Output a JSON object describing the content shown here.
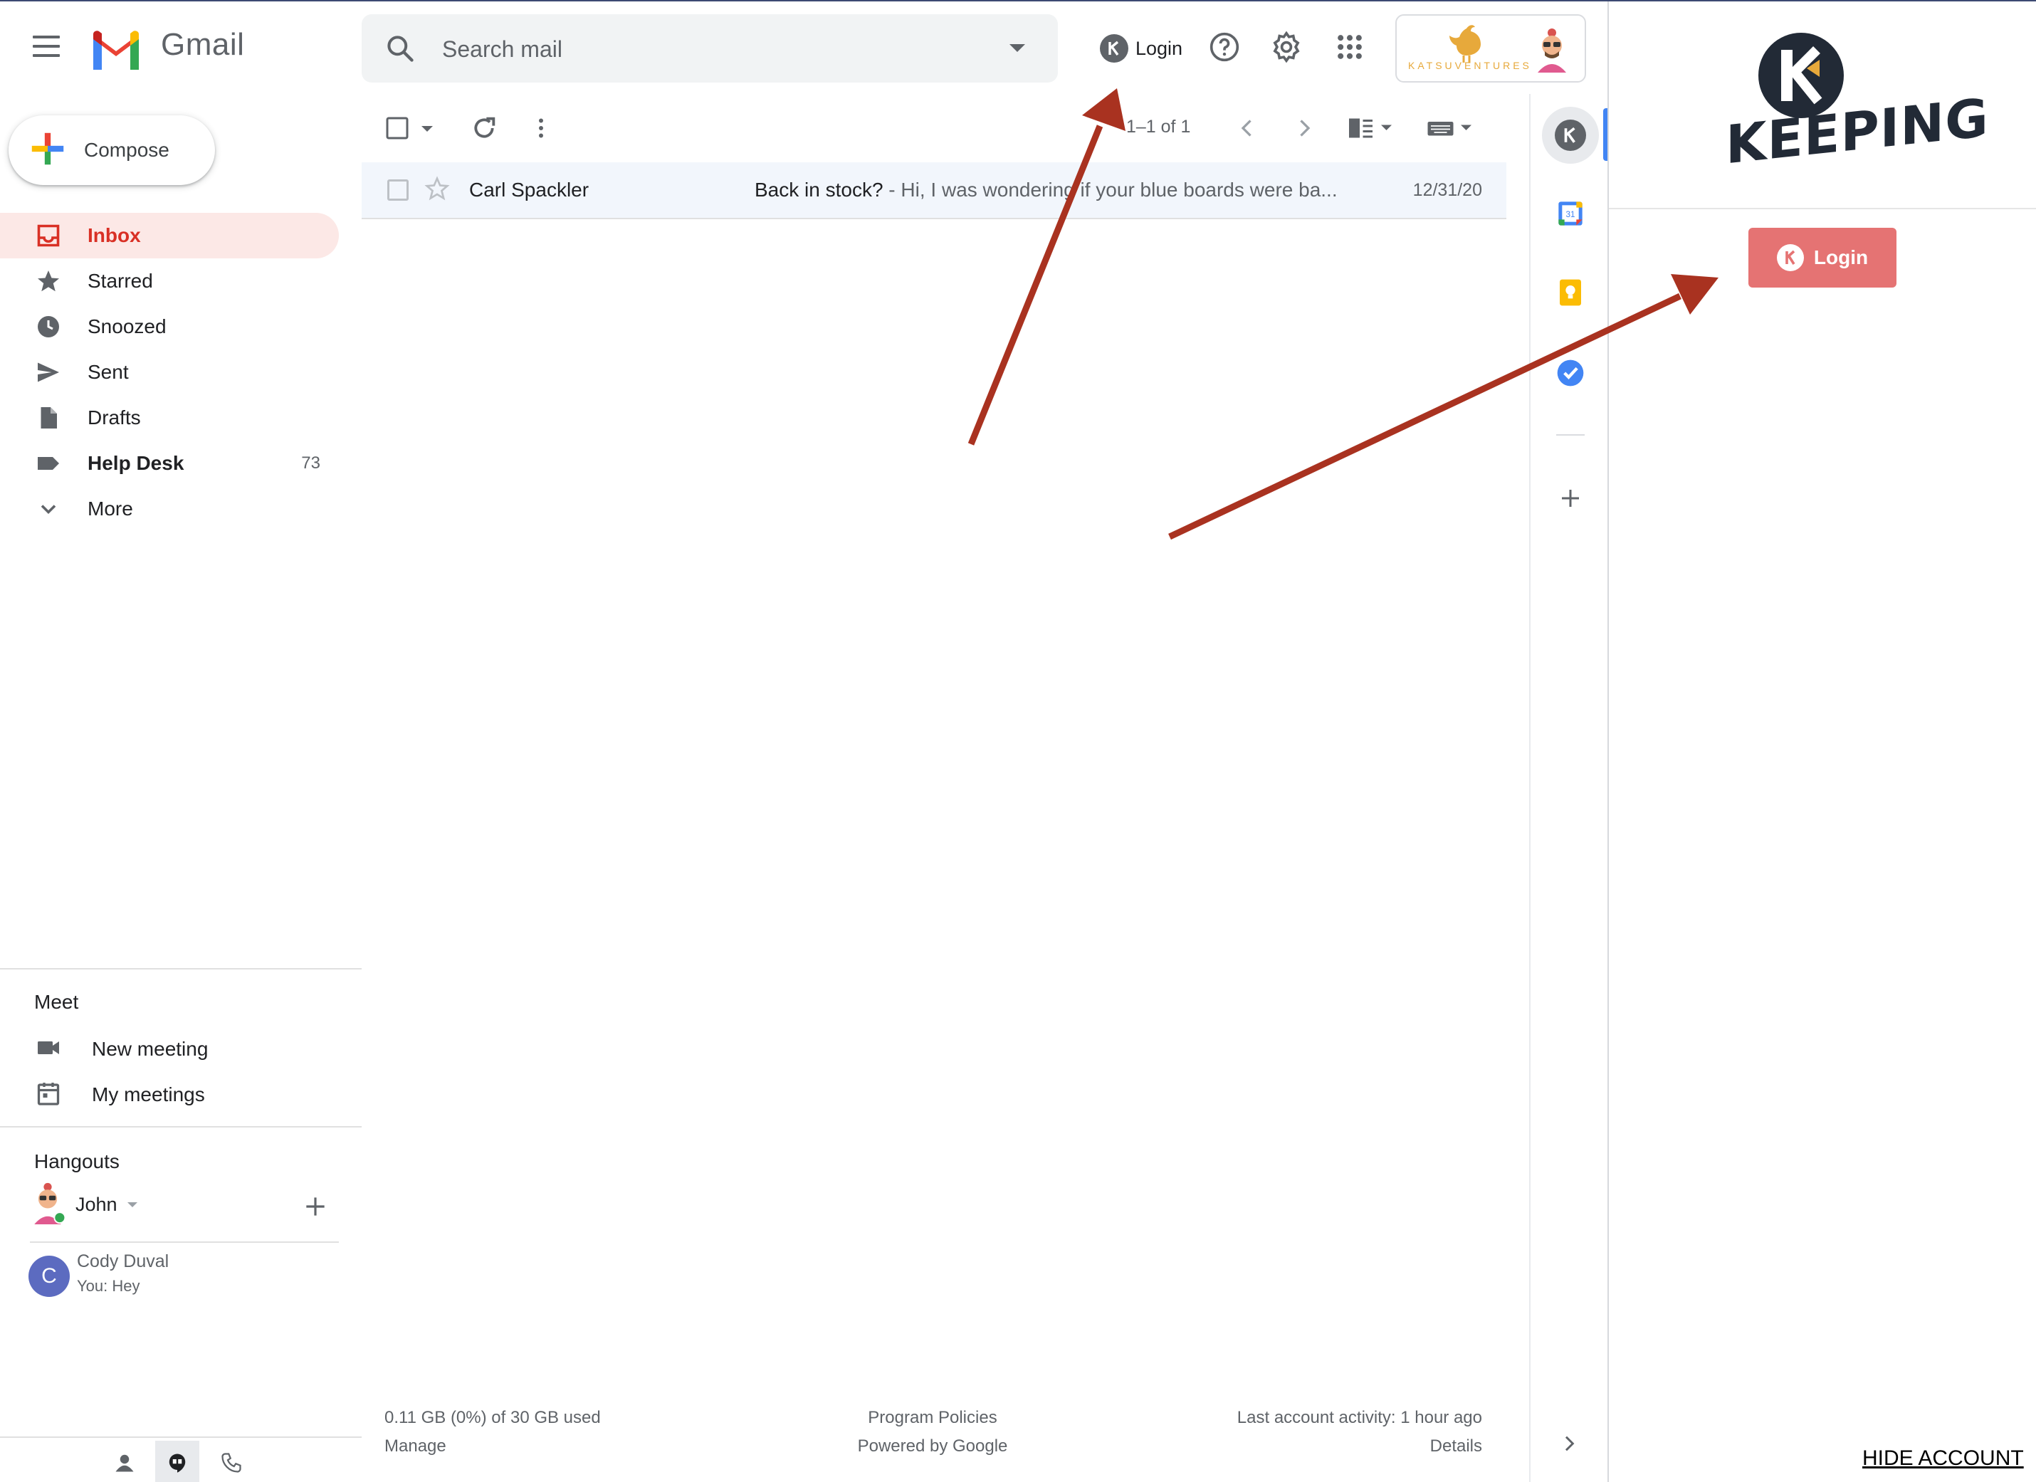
{
  "app": {
    "name": "Gmail"
  },
  "search": {
    "placeholder": "Search mail"
  },
  "header": {
    "keeping_login_label": "Login",
    "account_brand": "KATSUVENTURES"
  },
  "compose": {
    "label": "Compose"
  },
  "nav": {
    "items": [
      {
        "label": "Inbox",
        "icon": "inbox-icon",
        "selected": true
      },
      {
        "label": "Starred",
        "icon": "star-icon"
      },
      {
        "label": "Snoozed",
        "icon": "clock-icon"
      },
      {
        "label": "Sent",
        "icon": "send-icon"
      },
      {
        "label": "Drafts",
        "icon": "draft-icon"
      },
      {
        "label": "Help Desk",
        "icon": "label-icon",
        "count": "73"
      },
      {
        "label": "More",
        "icon": "chevron-down-icon"
      }
    ]
  },
  "meet": {
    "title": "Meet",
    "new_meeting": "New meeting",
    "my_meetings": "My meetings"
  },
  "hangouts": {
    "title": "Hangouts",
    "user": "John",
    "contact": {
      "initial": "C",
      "name": "Cody Duval",
      "last_message": "You: Hey"
    }
  },
  "toolbar": {
    "pagination": "1–1 of 1"
  },
  "emails": [
    {
      "from": "Carl Spackler",
      "subject": "Back in stock?",
      "snippet": " - Hi, I was wondering if your blue boards were ba...",
      "date": "12/31/20"
    }
  ],
  "footer": {
    "storage": "0.11 GB (0%) of 30 GB used",
    "manage": "Manage",
    "policies": "Program Policies",
    "powered": "Powered by Google",
    "activity": "Last account activity: 1 hour ago",
    "details": "Details"
  },
  "keeping": {
    "brand": "KEEPING",
    "login_label": "Login",
    "hide_account": "HIDE ACCOUNT"
  },
  "colors": {
    "gmail_red": "#d93025",
    "keeping_red": "#e57373",
    "arrow": "#a93220",
    "selected_bg": "#fce8e6"
  }
}
